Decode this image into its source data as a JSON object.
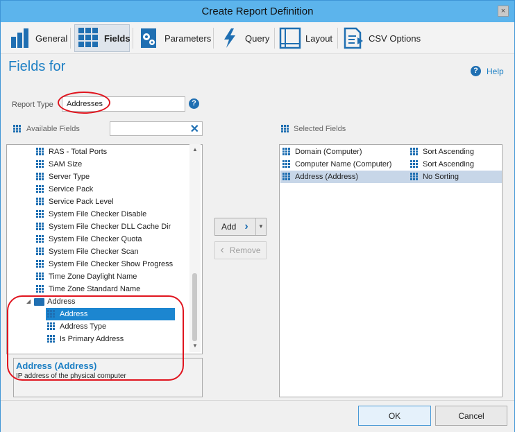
{
  "window": {
    "title": "Create Report Definition",
    "close_glyph": "×"
  },
  "toolbar": {
    "tabs": [
      {
        "label": "General",
        "icon": "bar-chart-icon"
      },
      {
        "label": "Fields",
        "icon": "grid-icon"
      },
      {
        "label": "Parameters",
        "icon": "gears-icon"
      },
      {
        "label": "Query",
        "icon": "lightning-icon"
      },
      {
        "label": "Layout",
        "icon": "layout-icon"
      },
      {
        "label": "CSV Options",
        "icon": "csv-export-icon"
      }
    ],
    "active": "Fields"
  },
  "heading": "Fields for",
  "help": {
    "label": "Help",
    "glyph": "?"
  },
  "report_type": {
    "label": "Report Type",
    "value": "Addresses",
    "help_glyph": "?"
  },
  "available": {
    "label": "Available Fields",
    "search_value": "",
    "clear_glyph": "✕"
  },
  "selected": {
    "label": "Selected Fields"
  },
  "available_items": [
    "RAS - Total Ports",
    "SAM Size",
    "Server Type",
    "Service Pack",
    "Service Pack Level",
    "System File Checker Disable",
    "System File Checker DLL Cache Dir",
    "System File Checker Quota",
    "System File Checker Scan",
    "System File Checker Show Progress",
    "Time Zone Daylight Name",
    "Time Zone Standard Name"
  ],
  "folder": {
    "label": "Address",
    "children": [
      "Address",
      "Address Type",
      "Is Primary Address"
    ],
    "selected_child": "Address"
  },
  "description": {
    "title": "Address (Address)",
    "text": "IP address of the physical computer"
  },
  "selected_fields": [
    {
      "field": "Domain (Computer)",
      "sort": "Sort Ascending"
    },
    {
      "field": "Computer Name (Computer)",
      "sort": "Sort Ascending"
    },
    {
      "field": "Address (Address)",
      "sort": "No Sorting"
    }
  ],
  "buttons": {
    "add": "Add",
    "remove": "Remove",
    "ok": "OK",
    "cancel": "Cancel"
  },
  "colors": {
    "accent": "#1c7fc4",
    "titlebar": "#5cb4ec",
    "selection": "#1c86d0",
    "annotation": "#e0141e"
  }
}
